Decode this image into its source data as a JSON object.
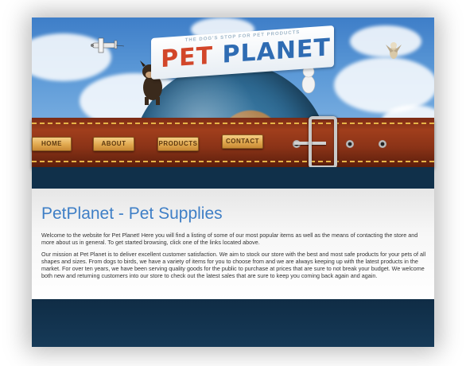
{
  "header": {
    "tagline": "THE DOG'S STOP FOR PET PRODUCTS",
    "logo_word1": "PET",
    "logo_word2": "PLANET"
  },
  "nav": {
    "items": [
      {
        "label": "HOME"
      },
      {
        "label": "ABOUT"
      },
      {
        "label": "PRODUCTS"
      },
      {
        "label": "CONTACT"
      }
    ]
  },
  "main": {
    "title": "PetPlanet - Pet Supplies",
    "paragraphs": [
      "Welcome to the website for Pet Planet! Here you will find a listing of some of our most popular items as well as the means of contacting the store and more about us in general. To get started browsing, click one of the links located above.",
      "Our mission at Pet Planet is to deliver excellent customer satisfaction. We aim to stock our store with the best and most safe products for your pets of all shapes and sizes. From dogs to birds, we have a variety of items for you to choose from and we are always keeping up with the latest products in the market. For over ten years, we have been serving quality goods for the public to purchase at prices that are sure to not break your budget. We welcome both new and returning customers into our store to check out the latest sales that are sure to keep you coming back again and again."
    ]
  },
  "colors": {
    "title_blue": "#3f7fc6",
    "collar_leather": "#8a3317",
    "nav_gold": "#e0a84e",
    "footer_navy": "#10304a"
  }
}
